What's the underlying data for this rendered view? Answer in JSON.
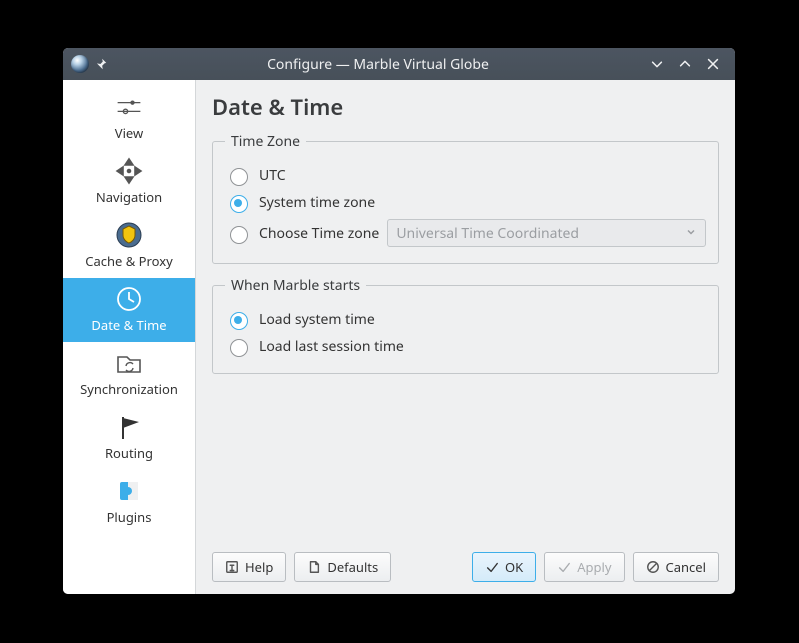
{
  "window": {
    "title": "Configure — Marble Virtual Globe"
  },
  "sidebar": {
    "items": [
      {
        "label": "View"
      },
      {
        "label": "Navigation"
      },
      {
        "label": "Cache & Proxy"
      },
      {
        "label": "Date & Time"
      },
      {
        "label": "Synchronization"
      },
      {
        "label": "Routing"
      },
      {
        "label": "Plugins"
      }
    ],
    "selected_index": 3
  },
  "page": {
    "heading": "Date & Time",
    "group_tz": {
      "legend": "Time Zone",
      "opt_utc": "UTC",
      "opt_system": "System time zone",
      "opt_choose": "Choose Time zone",
      "dropdown_value": "Universal Time Coordinated",
      "selected": "system"
    },
    "group_start": {
      "legend": "When Marble starts",
      "opt_load_system": "Load system time",
      "opt_load_last": "Load last session time",
      "selected": "load_system"
    }
  },
  "buttons": {
    "help": "Help",
    "defaults": "Defaults",
    "ok": "OK",
    "apply": "Apply",
    "cancel": "Cancel"
  }
}
